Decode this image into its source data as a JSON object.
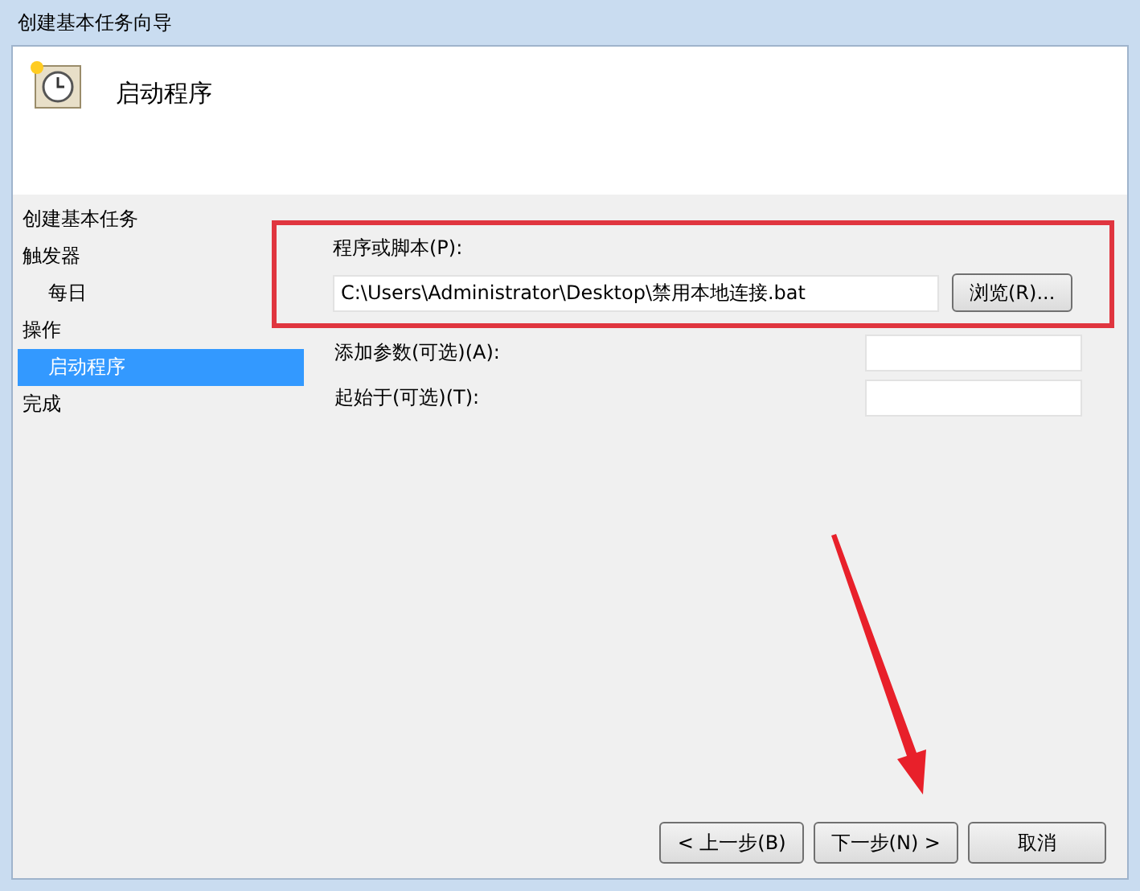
{
  "window": {
    "title": "创建基本任务向导"
  },
  "header": {
    "title": "启动程序"
  },
  "steps": [
    {
      "label": "创建基本任务",
      "selected": false
    },
    {
      "label": "触发器",
      "selected": false,
      "children": [
        {
          "label": "每日",
          "selected": false
        }
      ]
    },
    {
      "label": "操作",
      "selected": false,
      "children": [
        {
          "label": "启动程序",
          "selected": true
        }
      ]
    },
    {
      "label": "完成",
      "selected": false
    }
  ],
  "program": {
    "label": "程序或脚本(P):",
    "value": "C:\\Users\\Administrator\\Desktop\\禁用本地连接.bat",
    "browse": "浏览(R)..."
  },
  "fields": [
    {
      "label": "添加参数(可选)(A):"
    },
    {
      "label": "起始于(可选)(T):"
    }
  ],
  "buttons": [
    "< 上一步(B)",
    "下一步(N) >",
    "取消"
  ]
}
